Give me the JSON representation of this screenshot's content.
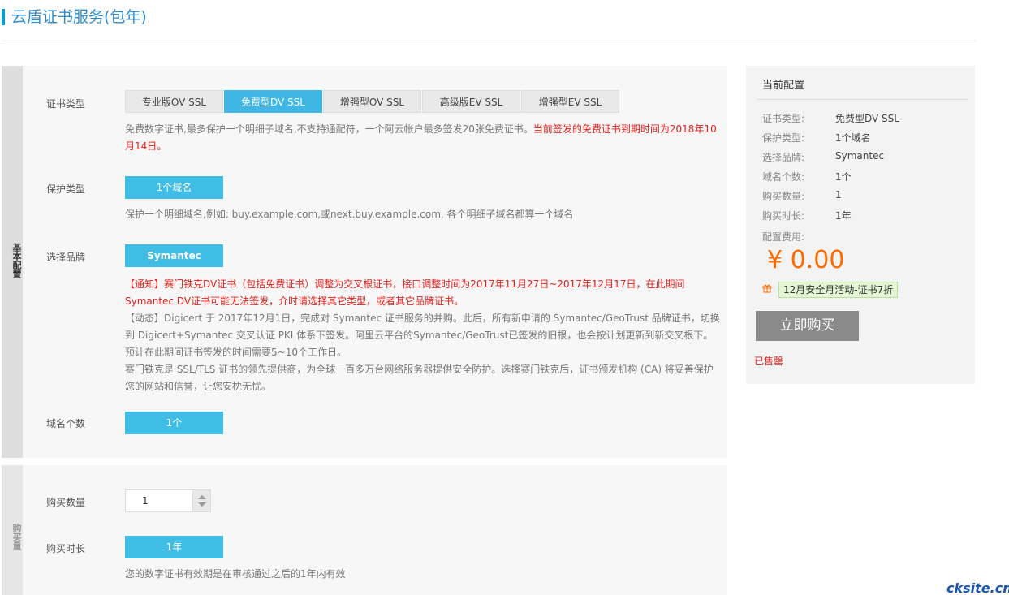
{
  "header": {
    "title": "云盾证书服务(包年)"
  },
  "basic": {
    "side_label": "基本配置",
    "cert_type": {
      "label": "证书类型",
      "tabs": [
        "专业版OV SSL",
        "免费型DV SSL",
        "增强型OV SSL",
        "高级版EV SSL",
        "增强型EV SSL"
      ],
      "active": 1,
      "desc": "免费数字证书,最多保护一个明细子域名,不支持通配符，一个阿云帐户最多签发20张免费证书。",
      "desc_red": "当前签发的免费证书到期时间为2018年10月14日。"
    },
    "protect": {
      "label": "保护类型",
      "option": "1个域名",
      "desc": "保护一个明细域名,例如: buy.example.com,或next.buy.example.com, 各个明细子域名都算一个域名"
    },
    "brand": {
      "label": "选择品牌",
      "option": "Symantec",
      "notice": "【通知】赛门铁克DV证书（包括免费证书）调整为交叉根证书，接口调整时间为2017年11月27日~2017年12月17日，在此期间Symantec DV证书可能无法签发，介时请选择其它类型，或者其它品牌证书。",
      "news": "【动态】Digicert 于 2017年12月1日，完成对 Symantec 证书服务的并购。此后，所有新申请的 Symantec/GeoTrust 品牌证书，切换到 Digicert+Symantec 交叉认证 PKI 体系下签发。阿里云平台的Symantec/GeoTrust已签发的旧根，也会按计划更新到新交叉根下。预计在此期间证书签发的时间需要5~10个工作日。",
      "intro": "赛门铁克是 SSL/TLS 证书的领先提供商，为全球一百多万台网络服务器提供安全防护。选择赛门铁克后，证书颁发机构 (CA) 将妥善保护您的网站和信誉，让您安枕无忧。"
    },
    "domains": {
      "label": "域名个数",
      "option": "1个"
    }
  },
  "purchase": {
    "side_label": "购买量",
    "qty": {
      "label": "购买数量",
      "value": "1"
    },
    "duration": {
      "label": "购买时长",
      "option": "1年",
      "desc": "您的数字证书有效期是在审核通过之后的1年内有效"
    }
  },
  "summary": {
    "title": "当前配置",
    "rows": [
      {
        "k": "证书类型:",
        "v": "免费型DV SSL"
      },
      {
        "k": "保护类型:",
        "v": "1个域名"
      },
      {
        "k": "选择品牌:",
        "v": "Symantec"
      },
      {
        "k": "域名个数:",
        "v": "1个"
      },
      {
        "k": "购买数量:",
        "v": "1"
      },
      {
        "k": "购买时长:",
        "v": "1年"
      }
    ],
    "fee_label": "配置费用:",
    "price": "¥ 0.00",
    "gift_icon": "gift-icon",
    "promo": "12月安全月活动-证书7折",
    "buy": "立即购买",
    "sold_out": "已售罄"
  },
  "watermark": "cksite.cn"
}
